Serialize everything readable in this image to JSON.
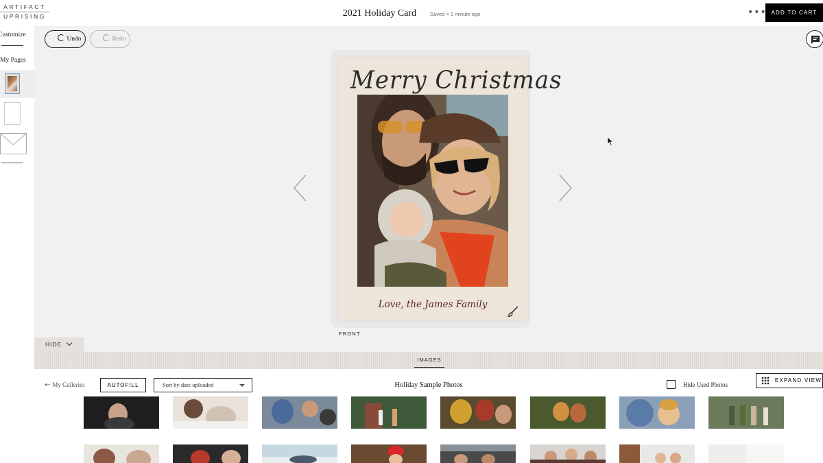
{
  "header": {
    "logo_line1": "ARTIFACT",
    "logo_line2": "UPRISING",
    "title": "2021 Holiday Card",
    "saved_status": "Saved < 1 minute ago",
    "more_label": "•••",
    "add_to_cart_label": "ADD TO CART"
  },
  "sidebar": {
    "customize_label": "Customize",
    "my_pages_label": "My Pages"
  },
  "toolbar": {
    "undo_label": "Undo",
    "redo_label": "Redo"
  },
  "card": {
    "headline": "Merry Christmas",
    "signoff": "Love, the James Family",
    "side_label": "FRONT"
  },
  "panel": {
    "hide_label": "HIDE",
    "images_tab_label": "IMAGES",
    "my_galleries_label": "My Galleries",
    "autofill_label": "AUTOFILL",
    "sort_selected": "Sort by date uploaded",
    "gallery_title": "Holiday Sample Photos",
    "hide_used_label": "Hide Used Photos",
    "expand_label": "EXPAND VIEW"
  },
  "colors": {
    "accent_black": "#000000",
    "card_background": "#ede5da",
    "canvas_background": "#f1f1f1",
    "signoff_color": "#5b2230",
    "selected_thumb_border": "#6b9ad6"
  },
  "icons": [
    "undo-icon",
    "redo-icon",
    "chat-icon",
    "chevron-left-icon",
    "chevron-right-icon",
    "brush-icon",
    "chevron-down-icon",
    "back-arrow-icon",
    "caret-down-icon",
    "grid-icon",
    "envelope-icon"
  ]
}
